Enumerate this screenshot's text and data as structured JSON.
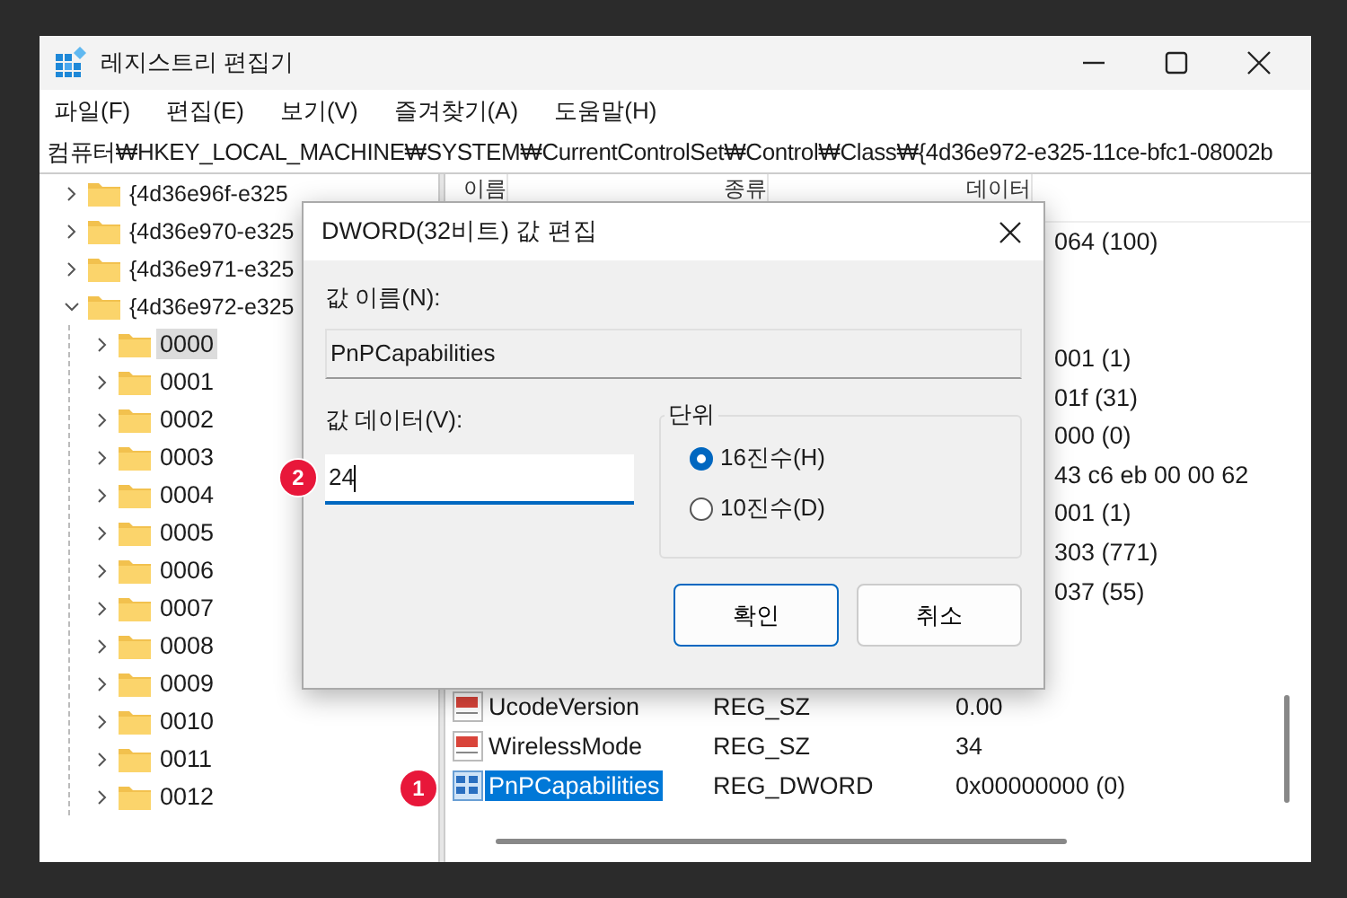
{
  "window": {
    "title": "레지스트리 편집기"
  },
  "menu": [
    "파일(F)",
    "편집(E)",
    "보기(V)",
    "즐겨찾기(A)",
    "도움말(H)"
  ],
  "address": "컴퓨터₩HKEY_LOCAL_MACHINE₩SYSTEM₩CurrentControlSet₩Control₩Class₩{4d36e972-e325-11ce-bfc1-08002b",
  "tree": [
    {
      "label": "{4d36e96f-e325",
      "expanded": false,
      "selected": false
    },
    {
      "label": "{4d36e970-e325",
      "expanded": false,
      "selected": false
    },
    {
      "label": "{4d36e971-e325",
      "expanded": false,
      "selected": false
    },
    {
      "label": "{4d36e972-e325",
      "expanded": true,
      "selected": false,
      "children": [
        {
          "label": "0000",
          "expanded": false,
          "selected": true
        },
        {
          "label": "0001",
          "expanded": false,
          "selected": false
        },
        {
          "label": "0002",
          "expanded": false,
          "selected": false
        },
        {
          "label": "0003",
          "expanded": false,
          "selected": false
        },
        {
          "label": "0004",
          "expanded": false,
          "selected": false
        },
        {
          "label": "0005",
          "expanded": false,
          "selected": false
        },
        {
          "label": "0006",
          "expanded": false,
          "selected": false
        },
        {
          "label": "0007",
          "expanded": false,
          "selected": false
        },
        {
          "label": "0008",
          "expanded": false,
          "selected": false
        },
        {
          "label": "0009",
          "expanded": false,
          "selected": false
        },
        {
          "label": "0010",
          "expanded": false,
          "selected": false
        },
        {
          "label": "0011",
          "expanded": false,
          "selected": false
        },
        {
          "label": "0012",
          "expanded": false,
          "selected": false
        }
      ]
    }
  ],
  "list": {
    "columns": [
      "이름",
      "종류",
      "데이터"
    ],
    "rows": [
      {
        "kind": "partial",
        "data": "064 (100)"
      },
      {
        "kind": "covered"
      },
      {
        "kind": "covered"
      },
      {
        "kind": "partial",
        "data": "001 (1)"
      },
      {
        "kind": "partial",
        "data": "01f (31)"
      },
      {
        "kind": "partial",
        "data": "000 (0)"
      },
      {
        "kind": "partial",
        "data": "43 c6 eb 00 00 62"
      },
      {
        "kind": "partial",
        "data": "001 (1)"
      },
      {
        "kind": "partial",
        "data": "303 (771)"
      },
      {
        "kind": "partial",
        "data": "037 (55)"
      },
      {
        "kind": "covered"
      },
      {
        "kind": "covered"
      },
      {
        "kind": "full",
        "icon": {
          "kind": "string"
        },
        "name": "UcodeVersion",
        "type": "REG_SZ",
        "data": "0.00",
        "selected": false
      },
      {
        "kind": "full",
        "icon": {
          "kind": "string"
        },
        "name": "WirelessMode",
        "type": "REG_SZ",
        "data": "34",
        "selected": false
      },
      {
        "kind": "full",
        "icon": {
          "kind": "binary"
        },
        "name": "PnPCapabilities",
        "type": "REG_DWORD",
        "data": "0x00000000 (0)",
        "selected": true,
        "badge": "1"
      }
    ]
  },
  "dialog": {
    "title": "DWORD(32비트) 값 편집",
    "name_label": "값 이름(N):",
    "name_value": "PnPCapabilities",
    "data_label": "값 데이터(V):",
    "data_value": "24",
    "data_badge": "2",
    "base_group": "단위",
    "bases": [
      {
        "label": "16진수(H)",
        "selected": true
      },
      {
        "label": "10진수(D)",
        "selected": false
      }
    ],
    "buttons": [
      {
        "label": "확인",
        "default": true
      },
      {
        "label": "취소",
        "default": false
      }
    ]
  }
}
